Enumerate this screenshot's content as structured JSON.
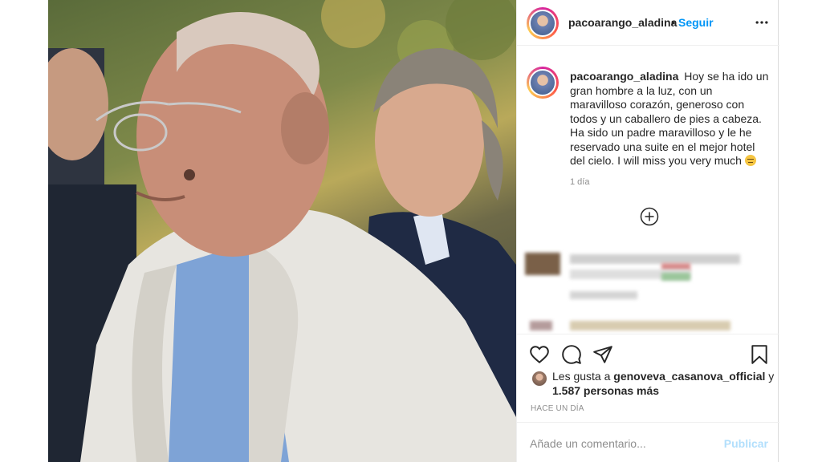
{
  "post": {
    "username": "pacoarango_aladina",
    "separator": "•",
    "follow_label": "Seguir",
    "caption_text": "Hoy se ha ido un gran hombre a la luz, con un maravilloso corazón, generoso con todos y un caballero de pies a cabeza. Ha sido un padre maravilloso y le he reservado una suite en el mejor hotel del cielo. I will miss you very much",
    "caption_time": "1 día",
    "likes_prefix": "Les gusta a",
    "likes_user": "genoveva_casanova_official",
    "likes_conjunction": "y",
    "likes_count": "1.587 personas más",
    "post_date": "HACE UN DÍA",
    "comment_placeholder": "Añade un comentario...",
    "publish_label": "Publicar"
  },
  "icons": {
    "more": "more-options-icon",
    "load_more": "load-more-comments-icon",
    "like": "heart-icon",
    "comment": "comment-icon",
    "share": "share-icon",
    "save": "bookmark-icon",
    "caption_emoji": "sad-face-emoji"
  },
  "colors": {
    "link_blue": "#0095f6",
    "publish_disabled": "#b2dffc",
    "muted_text": "#8e8e8e",
    "text": "#262626"
  }
}
